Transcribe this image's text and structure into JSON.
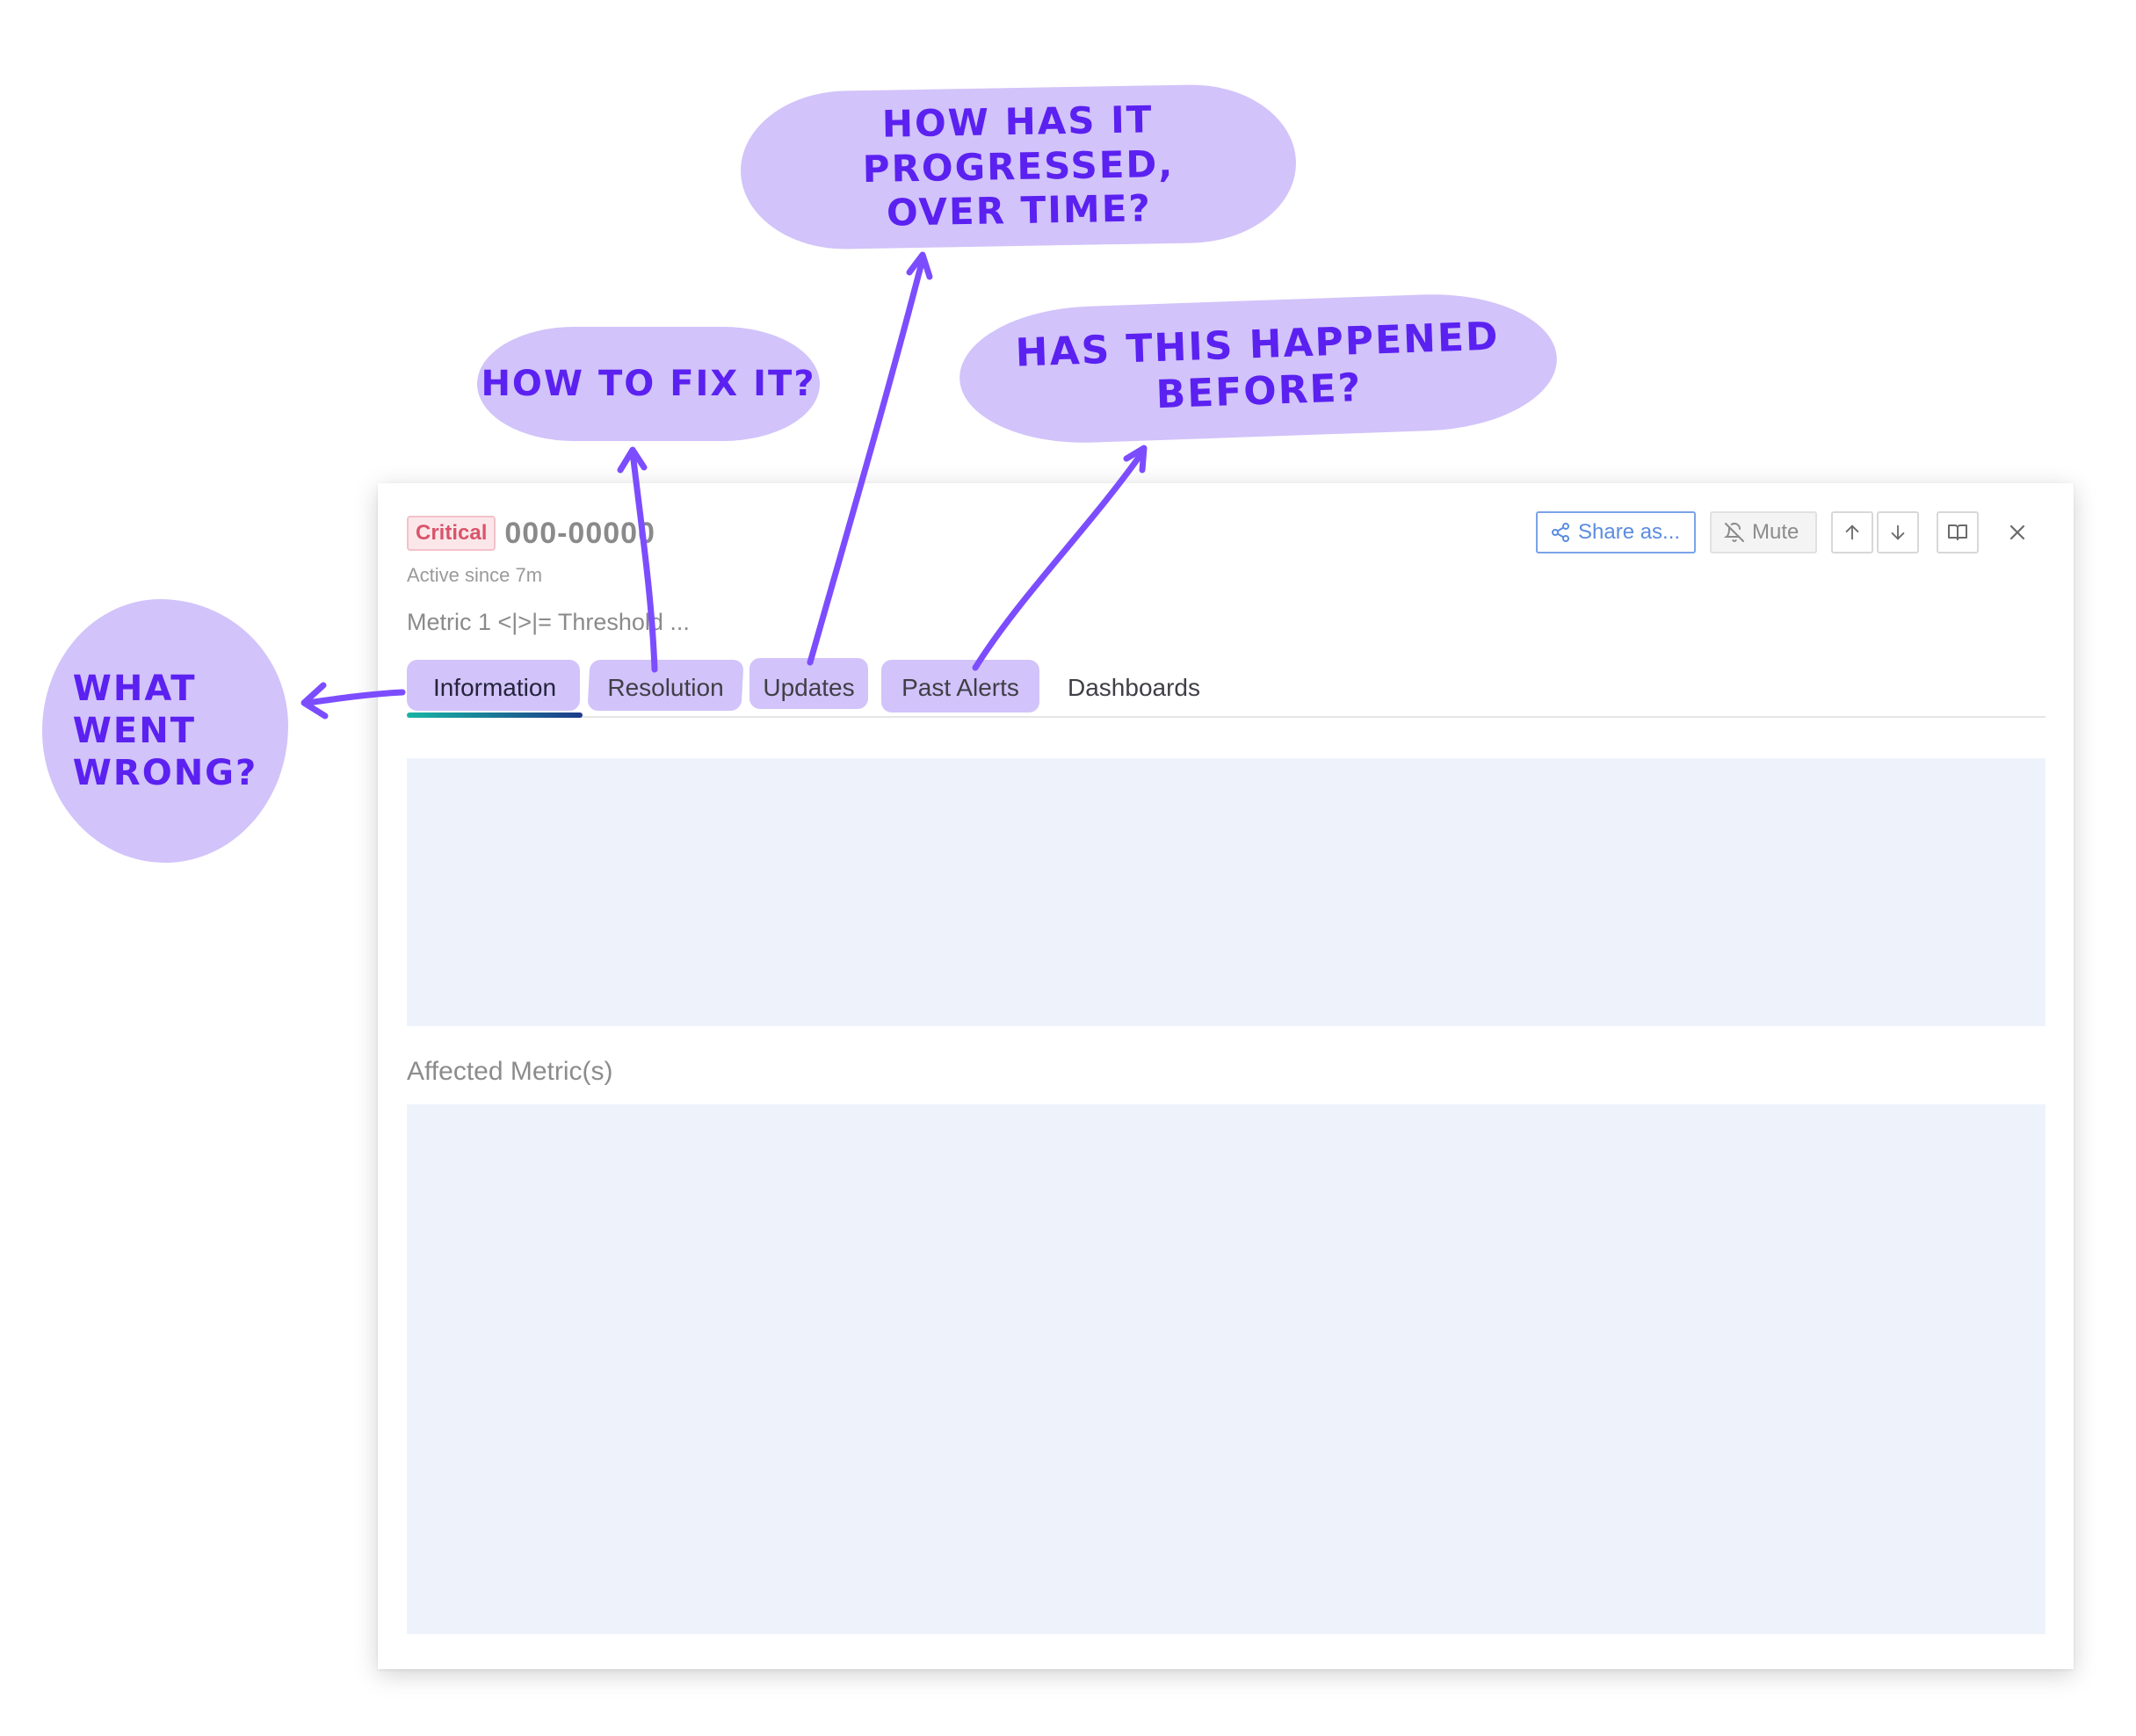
{
  "alert": {
    "severity": "Critical",
    "id": "000-00000",
    "active_since": "Active since 7m",
    "metric_summary": "Metric 1 <|>|= Threshold ..."
  },
  "toolbar": {
    "share_label": "Share as...",
    "mute_label": "Mute"
  },
  "tabs": [
    {
      "label": "Information",
      "active": true
    },
    {
      "label": "Resolution",
      "active": false
    },
    {
      "label": "Updates",
      "active": false
    },
    {
      "label": "Past Alerts",
      "active": false
    },
    {
      "label": "Dashboards",
      "active": false
    }
  ],
  "sections": {
    "affected_metrics_label": "Affected Metric(s)"
  },
  "annotations": {
    "progress": {
      "line1": "HOW HAS IT PROGRESSED,",
      "line2": "OVER TIME?"
    },
    "fix": "HOW TO FIX IT?",
    "before": "HAS THIS HAPPENED BEFORE?",
    "wrong": {
      "line1": "WHAT",
      "line2": "WENT",
      "line3": "WRONG?"
    }
  },
  "icons": {
    "share": "share-icon",
    "mute": "bell-off-icon",
    "up": "arrow-up-icon",
    "down": "arrow-down-icon",
    "book": "book-icon",
    "close": "close-icon"
  },
  "colors": {
    "accent_purple": "#5b21f0",
    "highlight": "#d2c3fa",
    "critical": "#d9546a",
    "share_blue": "#5b8ce0",
    "placeholder": "#eef3fb"
  }
}
